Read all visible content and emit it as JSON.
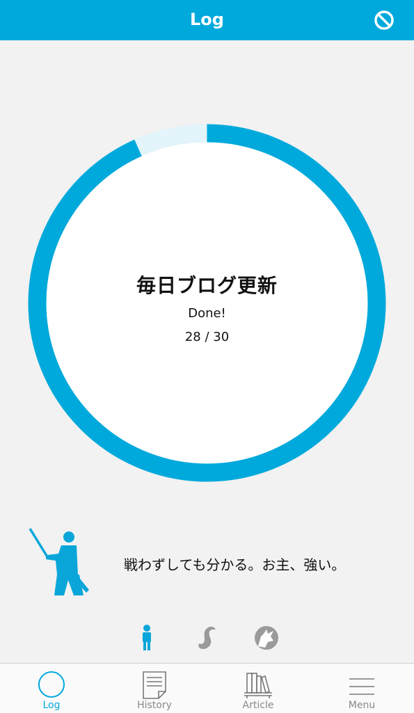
{
  "header": {
    "title": "Log",
    "action_icon": "prohibited-icon"
  },
  "goal": {
    "title": "毎日ブログ更新",
    "status": "Done!",
    "count_text": "28 / 30",
    "completed": 28,
    "total": 30
  },
  "colors": {
    "accent": "#00a9db",
    "ring_remaining": "#e3f4fb",
    "background": "#f2f2f2"
  },
  "character": {
    "quote": "戦わずしても分かる。お主、強い。",
    "icon": "samurai-icon",
    "options": [
      {
        "icon": "samurai-small-icon",
        "selected": true
      },
      {
        "icon": "goose-icon",
        "selected": false
      },
      {
        "icon": "wolf-icon",
        "selected": false
      }
    ]
  },
  "tabs": [
    {
      "label": "Log",
      "icon": "circle-icon",
      "active": true
    },
    {
      "label": "History",
      "icon": "document-icon",
      "active": false
    },
    {
      "label": "Article",
      "icon": "bookshelf-icon",
      "active": false
    },
    {
      "label": "Menu",
      "icon": "hamburger-icon",
      "active": false
    }
  ]
}
